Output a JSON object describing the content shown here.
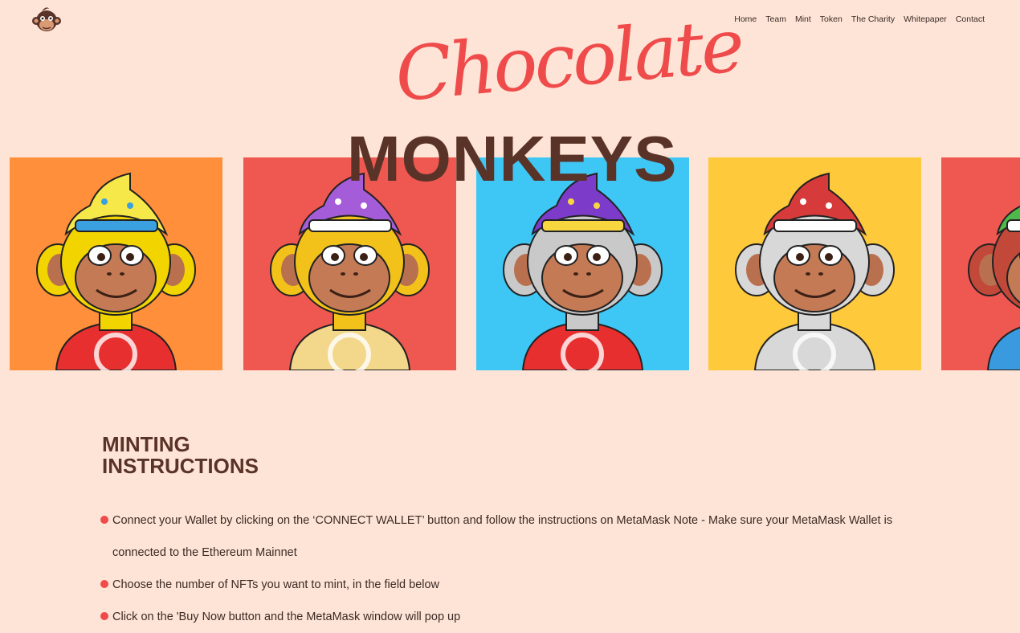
{
  "logo": {
    "name": "monkey-logo-icon"
  },
  "nav": {
    "items": [
      "Home",
      "Team",
      "Mint",
      "Token",
      "The Charity",
      "Whitepaper",
      "Contact"
    ]
  },
  "hero": {
    "title_script": "Chocolate",
    "title_bold": "MONKEYS"
  },
  "gallery": {
    "cards": [
      {
        "name": "monkey-wizard-orange",
        "bg": "#ff8f3a",
        "fur": "#f2d400",
        "hat": "#f7e84a",
        "hat_accent": "#3aa0e0",
        "shirt": "#e82f2f"
      },
      {
        "name": "monkey-beanie-red",
        "bg": "#ef5850",
        "fur": "#f2c21a",
        "hat": "#a55cd8",
        "hat_accent": "#ffffff",
        "shirt": "#f3d78a"
      },
      {
        "name": "monkey-wizard-blue",
        "bg": "#3ec6f4",
        "fur": "#c9c9c9",
        "hat": "#7c3bc9",
        "hat_accent": "#f7d640",
        "shirt": "#e82f2f"
      },
      {
        "name": "monkey-cap-yellow",
        "bg": "#ffc93c",
        "fur": "#d8d8d8",
        "hat": "#d63a3a",
        "hat_accent": "#ffffff",
        "shirt": "#d8d8d8"
      },
      {
        "name": "monkey-cap-red",
        "bg": "#ef5850",
        "fur": "#c2483a",
        "hat": "#4fb84a",
        "hat_accent": "#ffffff",
        "shirt": "#3a9ae0"
      }
    ]
  },
  "minting": {
    "title_line1": "MINTING",
    "title_line2": "INSTRUCTIONS",
    "steps": [
      "Connect your Wallet by clicking on the ‘CONNECT WALLET’ button and follow the instructions on MetaMask Note - Make sure your MetaMask Wallet is connected to the Ethereum Mainnet",
      "Choose the number of NFTs you want to mint, in the field below",
      "Click on the 'Buy Now button and the MetaMask window will pop up"
    ]
  }
}
